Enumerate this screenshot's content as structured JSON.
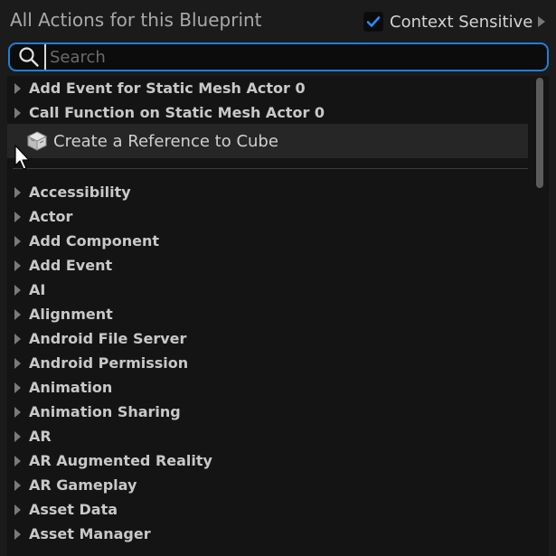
{
  "header": {
    "title": "All Actions for this Blueprint",
    "context_sensitive_label": "Context Sensitive",
    "context_sensitive_checked": true
  },
  "search": {
    "placeholder": "Search",
    "value": ""
  },
  "top_items": [
    {
      "label": "Add Event for Static Mesh Actor 0"
    },
    {
      "label": "Call Function on Static Mesh Actor 0"
    }
  ],
  "reference_item": {
    "label": "Create a Reference to Cube",
    "icon": "cube-icon"
  },
  "categories": [
    {
      "label": "Accessibility"
    },
    {
      "label": "Actor"
    },
    {
      "label": "Add Component"
    },
    {
      "label": "Add Event"
    },
    {
      "label": "AI"
    },
    {
      "label": "Alignment"
    },
    {
      "label": "Android File Server"
    },
    {
      "label": "Android Permission"
    },
    {
      "label": "Animation"
    },
    {
      "label": "Animation Sharing"
    },
    {
      "label": "AR"
    },
    {
      "label": "AR Augmented Reality"
    },
    {
      "label": "AR Gameplay"
    },
    {
      "label": "Asset Data"
    },
    {
      "label": "Asset Manager"
    }
  ],
  "colors": {
    "accent": "#1e7fd9",
    "checkmark": "#2a8cf0",
    "background": "#1b1b1b",
    "list_background": "#141414",
    "selected_row": "#262626"
  }
}
